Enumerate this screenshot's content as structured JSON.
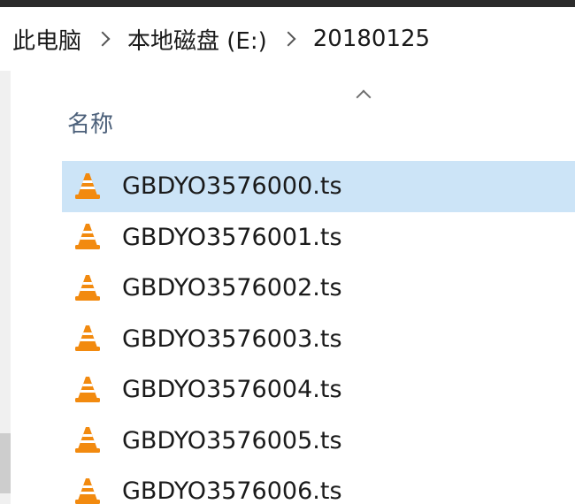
{
  "breadcrumb": {
    "items": [
      "此电脑",
      "本地磁盘 (E:)",
      "20180125"
    ]
  },
  "columns": {
    "name_header": "名称"
  },
  "files": [
    {
      "name": "GBDYO3576000.ts",
      "selected": true
    },
    {
      "name": "GBDYO3576001.ts",
      "selected": false
    },
    {
      "name": "GBDYO3576002.ts",
      "selected": false
    },
    {
      "name": "GBDYO3576003.ts",
      "selected": false
    },
    {
      "name": "GBDYO3576004.ts",
      "selected": false
    },
    {
      "name": "GBDYO3576005.ts",
      "selected": false
    },
    {
      "name": "GBDYO3576006.ts",
      "selected": false
    }
  ],
  "icons": {
    "file_icon": "vlc-media-file-icon",
    "separator_icon": "chevron-right-icon",
    "sort_icon": "sort-ascending-icon"
  },
  "colors": {
    "selection": "#cce4f7",
    "header_text": "#4c607a",
    "vlc_orange": "#f28a0f"
  }
}
